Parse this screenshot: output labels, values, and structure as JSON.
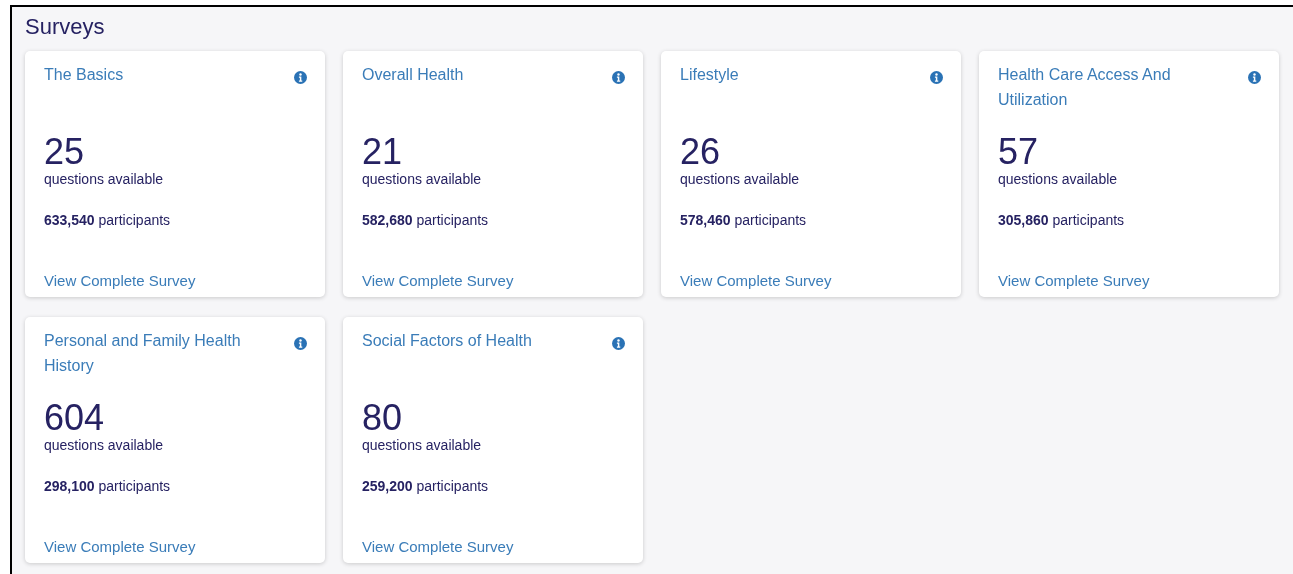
{
  "heading": "Surveys",
  "surveys": [
    {
      "title": "The Basics",
      "questions": "25",
      "questions_label": "questions available",
      "participants": "**633,540** participants",
      "link": "View Complete Survey"
    },
    {
      "title": "Overall Health",
      "questions": "21",
      "questions_label": "questions available",
      "participants": "**582,680** participants",
      "link": "View Complete Survey"
    },
    {
      "title": "Lifestyle",
      "questions": "26",
      "questions_label": "questions available",
      "participants": "**578,460** participants",
      "link": "View Complete Survey"
    },
    {
      "title": "Health Care Access And Utilization",
      "questions": "57",
      "questions_label": "questions available",
      "participants": "**305,860** participants",
      "link": "View Complete Survey"
    },
    {
      "title": "Personal and Family Health History",
      "questions": "604",
      "questions_label": "questions available",
      "participants": "**298,100** participants",
      "link": "View Complete Survey"
    },
    {
      "title": "Social Factors of Health",
      "questions": "80",
      "questions_label": "questions available",
      "participants": "**259,200** participants",
      "link": "View Complete Survey"
    }
  ]
}
